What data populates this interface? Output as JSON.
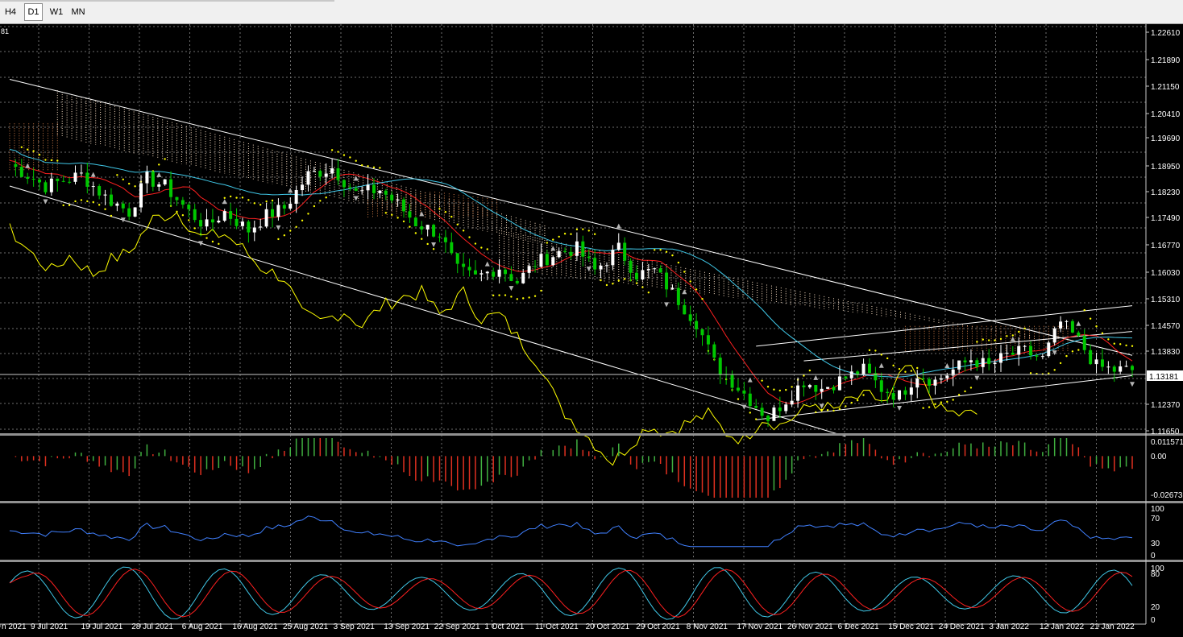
{
  "toolbar": {
    "timeframes": [
      {
        "label": "H4",
        "active": false
      },
      {
        "label": "D1",
        "active": true
      },
      {
        "label": "W1",
        "active": false
      },
      {
        "label": "MN",
        "active": false
      }
    ]
  },
  "corner_label": "81",
  "chart_data": {
    "type": "candlestick",
    "price_axis": {
      "ticks": [
        "1.22610",
        "1.21890",
        "1.21150",
        "1.20410",
        "1.19690",
        "1.18950",
        "1.18230",
        "1.17490",
        "1.16770",
        "1.16030",
        "1.15310",
        "1.14570",
        "1.13830",
        "1.13181",
        "1.12370",
        "1.11650"
      ],
      "range": [
        1.1165,
        1.2261
      ],
      "current_price": "1.13181"
    },
    "date_labels": [
      "9 Jul 2021",
      "19 Jul 2021",
      "28 Jul 2021",
      "6 Aug 2021",
      "16 Aug 2021",
      "25 Aug 2021",
      "3 Sep 2021",
      "13 Sep 2021",
      "22 Sep 2021",
      "1 Oct 2021",
      "11 Oct 2021",
      "20 Oct 2021",
      "29 Oct 2021",
      "8 Nov 2021",
      "17 Nov 2021",
      "26 Nov 2021",
      "6 Dec 2021",
      "15 Dec 2021",
      "24 Dec 2021",
      "3 Jan 2022",
      "12 Jan 2022",
      "21 Jan 2022"
    ],
    "price_path": [
      [
        0,
        1.189
      ],
      [
        6,
        1.183
      ],
      [
        12,
        1.186
      ],
      [
        16,
        1.18
      ],
      [
        20,
        1.176
      ],
      [
        23,
        1.185
      ],
      [
        26,
        1.183
      ],
      [
        30,
        1.176
      ],
      [
        33,
        1.172
      ],
      [
        36,
        1.176
      ],
      [
        40,
        1.171
      ],
      [
        43,
        1.175
      ],
      [
        46,
        1.177
      ],
      [
        50,
        1.186
      ],
      [
        54,
        1.188
      ],
      [
        58,
        1.181
      ],
      [
        62,
        1.182
      ],
      [
        65,
        1.178
      ],
      [
        68,
        1.173
      ],
      [
        72,
        1.17
      ],
      [
        75,
        1.16
      ],
      [
        78,
        1.158
      ],
      [
        82,
        1.161
      ],
      [
        85,
        1.157
      ],
      [
        88,
        1.162
      ],
      [
        92,
        1.165
      ],
      [
        95,
        1.166
      ],
      [
        98,
        1.16
      ],
      [
        102,
        1.166
      ],
      [
        105,
        1.159
      ],
      [
        108,
        1.16
      ],
      [
        112,
        1.152
      ],
      [
        115,
        1.146
      ],
      [
        118,
        1.135
      ],
      [
        121,
        1.13
      ],
      [
        124,
        1.125
      ],
      [
        127,
        1.12
      ],
      [
        130,
        1.125
      ],
      [
        133,
        1.13
      ],
      [
        136,
        1.128
      ],
      [
        140,
        1.131
      ],
      [
        143,
        1.133
      ],
      [
        146,
        1.128
      ],
      [
        149,
        1.126
      ],
      [
        152,
        1.132
      ],
      [
        155,
        1.13
      ],
      [
        158,
        1.133
      ],
      [
        161,
        1.136
      ],
      [
        164,
        1.134
      ],
      [
        167,
        1.137
      ],
      [
        170,
        1.138
      ],
      [
        173,
        1.136
      ],
      [
        176,
        1.146
      ],
      [
        179,
        1.141
      ],
      [
        182,
        1.134
      ],
      [
        185,
        1.133
      ],
      [
        188,
        1.133
      ]
    ],
    "trend_lines": [
      {
        "from": [
          0,
          1.212
        ],
        "to": [
          188,
          1.137
        ]
      },
      {
        "from": [
          0,
          1.183
        ],
        "to": [
          140,
          1.115
        ]
      },
      {
        "from": [
          125,
          1.1395
        ],
        "to": [
          188,
          1.1505
        ]
      },
      {
        "from": [
          125,
          1.1195
        ],
        "to": [
          188,
          1.1315
        ]
      },
      {
        "from": [
          133,
          1.1355
        ],
        "to": [
          188,
          1.1435
        ]
      }
    ],
    "indicators": {
      "macd": {
        "labels": [
          "0.011571",
          "0.00",
          "-0.026738"
        ],
        "range": [
          -0.026738,
          0.011571
        ]
      },
      "rsi": {
        "labels": [
          "100",
          "70",
          "30",
          "0"
        ],
        "levels": [
          70,
          30
        ]
      },
      "stochastic": {
        "labels": [
          "100",
          "80",
          "20",
          "0"
        ],
        "levels": [
          80,
          20
        ]
      }
    },
    "colors": {
      "bull": "#ffffff",
      "bear": "#00c800",
      "tenkan": "#ff2020",
      "kijun": "#40c8e8",
      "chikou": "#ffff00",
      "psar": "#ffff00",
      "cloud_a": "#ffe4c8",
      "cloud_b": "#c87846",
      "macd_pos": "#40b040",
      "macd_neg": "#e03020",
      "rsi": "#4080ff",
      "stoch_main": "#40c8e8",
      "stoch_signal": "#ff2020",
      "grid": "#6e6e6e",
      "trend": "#ffffff"
    }
  }
}
